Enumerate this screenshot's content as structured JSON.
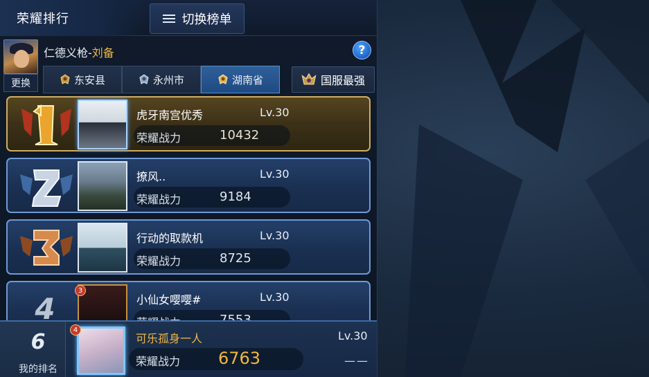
{
  "header": {
    "title": "荣耀排行",
    "switch_label": "切换榜单"
  },
  "user": {
    "name_prefix": "仁德义枪-",
    "hero_name": "刘备",
    "change_label": "更换",
    "help_label": "?"
  },
  "region_tabs": [
    {
      "label": "东安县",
      "active": false
    },
    {
      "label": "永州市",
      "active": false
    },
    {
      "label": "湖南省",
      "active": true
    }
  ],
  "nation_button": {
    "label": "国服最强"
  },
  "ranking": {
    "power_label": "荣耀战力",
    "rows": [
      {
        "rank": "1",
        "name": "虎牙南宫优秀",
        "level": "Lv.30",
        "power": "10432"
      },
      {
        "rank": "2",
        "name": "撩风..",
        "level": "Lv.30",
        "power": "9184"
      },
      {
        "rank": "3",
        "name": "行动的取款机",
        "level": "Lv.30",
        "power": "8725"
      },
      {
        "rank": "4",
        "name": "小仙女嘤嘤#",
        "level": "Lv.30",
        "power": "7553",
        "badge": "3"
      }
    ]
  },
  "my_rank": {
    "rank": "6",
    "label": "我的排名",
    "name": "可乐孤身一人",
    "level": "Lv.30",
    "power_label": "荣耀战力",
    "power": "6763",
    "change": "——",
    "badge": "4"
  },
  "colors": {
    "accent_gold": "#f1b73f",
    "row_border_blue": "#6e9ad6",
    "row_border_gold": "#d2ad60",
    "active_tab": "#2f5f9a"
  },
  "icons": {
    "list": "list-icon",
    "help": "question-icon",
    "region_emblem": "rank-emblem-icon",
    "nation_emblem": "king-emblem-icon",
    "medal_1": "gold-medal-icon",
    "medal_2": "silver-medal-icon",
    "medal_3": "bronze-medal-icon"
  }
}
